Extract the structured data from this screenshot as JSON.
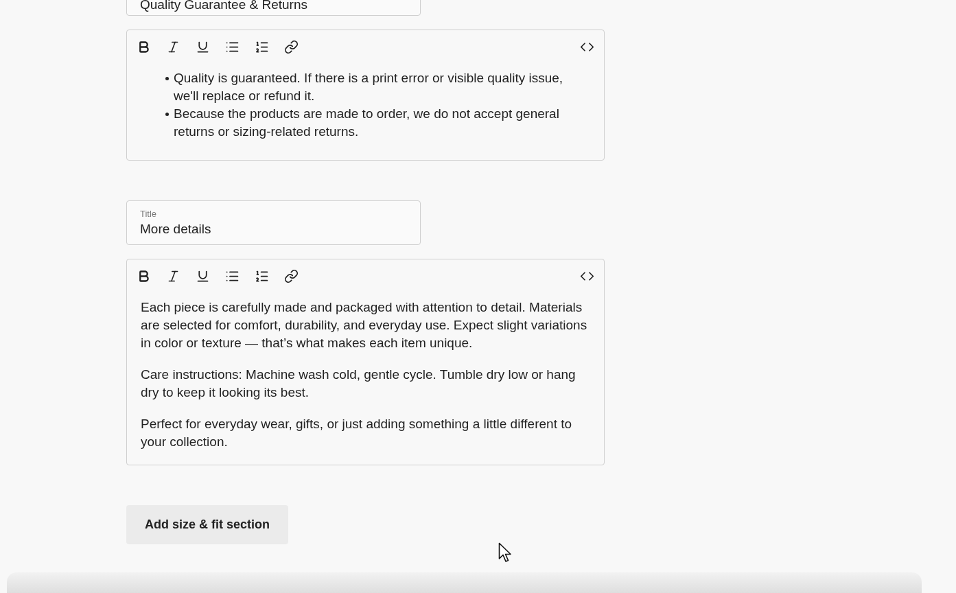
{
  "sections": [
    {
      "title_field": {
        "value": "Quality Guarantee & Returns"
      },
      "editor": {
        "content": [
          {
            "kind": "bullet_list",
            "items": [
              "Quality is guaranteed. If there is a print error or visible quality issue, we'll replace or refund it.",
              "Because the products are made to order, we do not accept general returns or sizing-related returns."
            ]
          }
        ]
      }
    },
    {
      "title_field": {
        "label": "Title",
        "value": "More details"
      },
      "editor": {
        "content": [
          {
            "kind": "paragraph",
            "text": "Each piece is carefully made and packaged with attention to detail. Materials are selected for comfort, durability, and everyday use. Expect slight variations in color or texture — that’s what makes each item unique."
          },
          {
            "kind": "paragraph",
            "text": "Care instructions: Machine wash cold, gentle cycle. Tumble dry low or hang dry to keep it looking its best."
          },
          {
            "kind": "paragraph",
            "text": "Perfect for everyday wear, gifts, or just adding something a little different to your collection."
          }
        ]
      }
    }
  ],
  "add_button": {
    "label": "Add size & fit section"
  }
}
